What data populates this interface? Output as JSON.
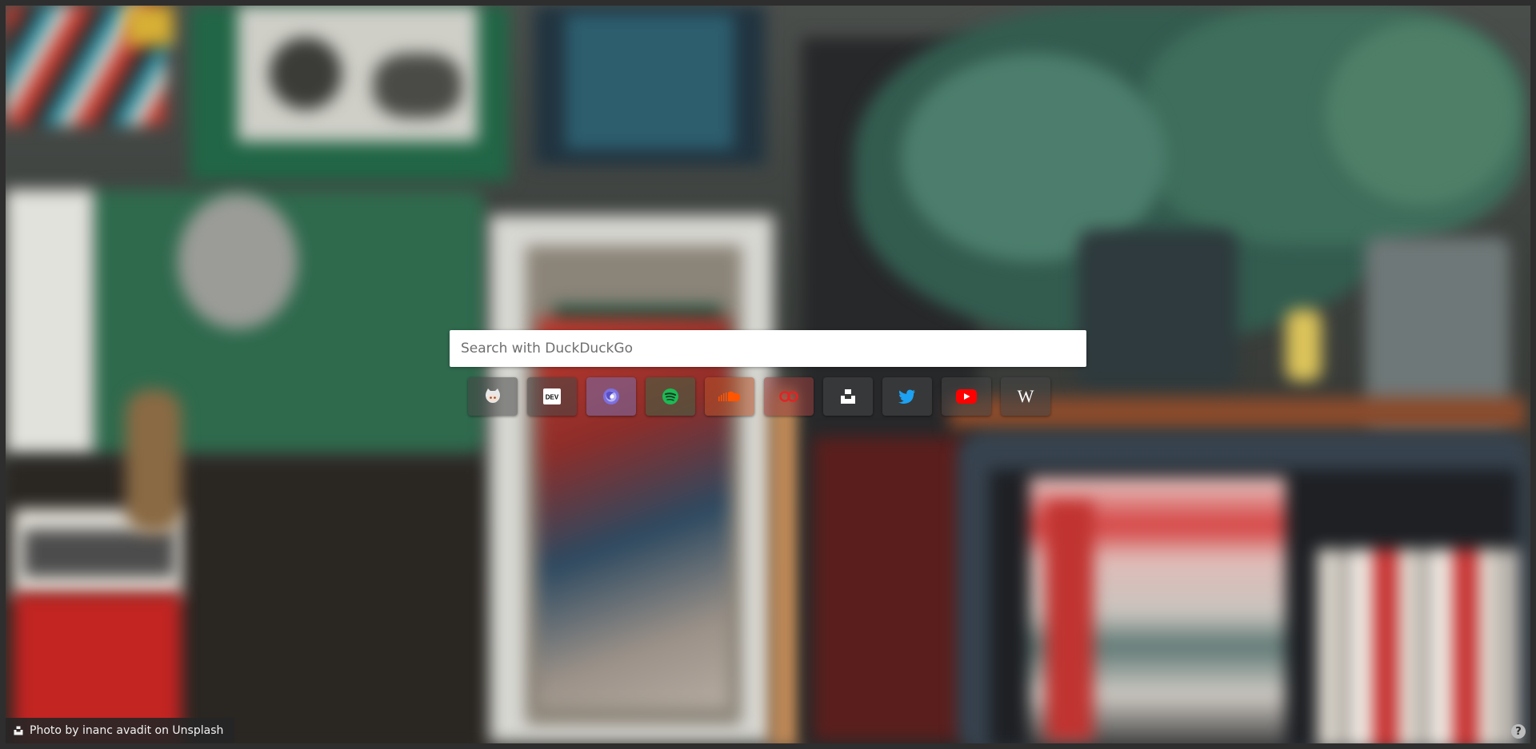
{
  "search": {
    "placeholder": "Search with DuckDuckGo",
    "value": ""
  },
  "shortcuts": [
    {
      "name": "GitHub",
      "icon": "github-octocat-icon",
      "color": "#ffffff"
    },
    {
      "name": "DEV",
      "icon": "dev-to-icon",
      "label": "DEV",
      "color": "#ffffff"
    },
    {
      "name": "Firefox",
      "icon": "firefox-icon",
      "color": "#6f6bd6"
    },
    {
      "name": "Spotify",
      "icon": "spotify-icon",
      "color": "#1db954"
    },
    {
      "name": "SoundCloud",
      "icon": "soundcloud-icon",
      "color": "#ff5500"
    },
    {
      "name": "Bandcamp-like",
      "icon": "red-infinity-icon",
      "color": "#e02424"
    },
    {
      "name": "Unsplash",
      "icon": "unsplash-icon",
      "color": "#ffffff"
    },
    {
      "name": "Twitter",
      "icon": "twitter-bird-icon",
      "color": "#1da1f2"
    },
    {
      "name": "YouTube",
      "icon": "youtube-icon",
      "color": "#ff0000"
    },
    {
      "name": "Wikipedia",
      "icon": "wikipedia-icon",
      "label": "W",
      "color": "#ffffff"
    }
  ],
  "credit": {
    "text": "Photo by inanc avadit on Unsplash",
    "icon": "camera-icon"
  },
  "help": {
    "label": "?",
    "icon": "help-icon"
  },
  "colors": {
    "frame": "#2e2e2e",
    "search_bg": "#ffffff",
    "credit_bg": "#262626"
  }
}
